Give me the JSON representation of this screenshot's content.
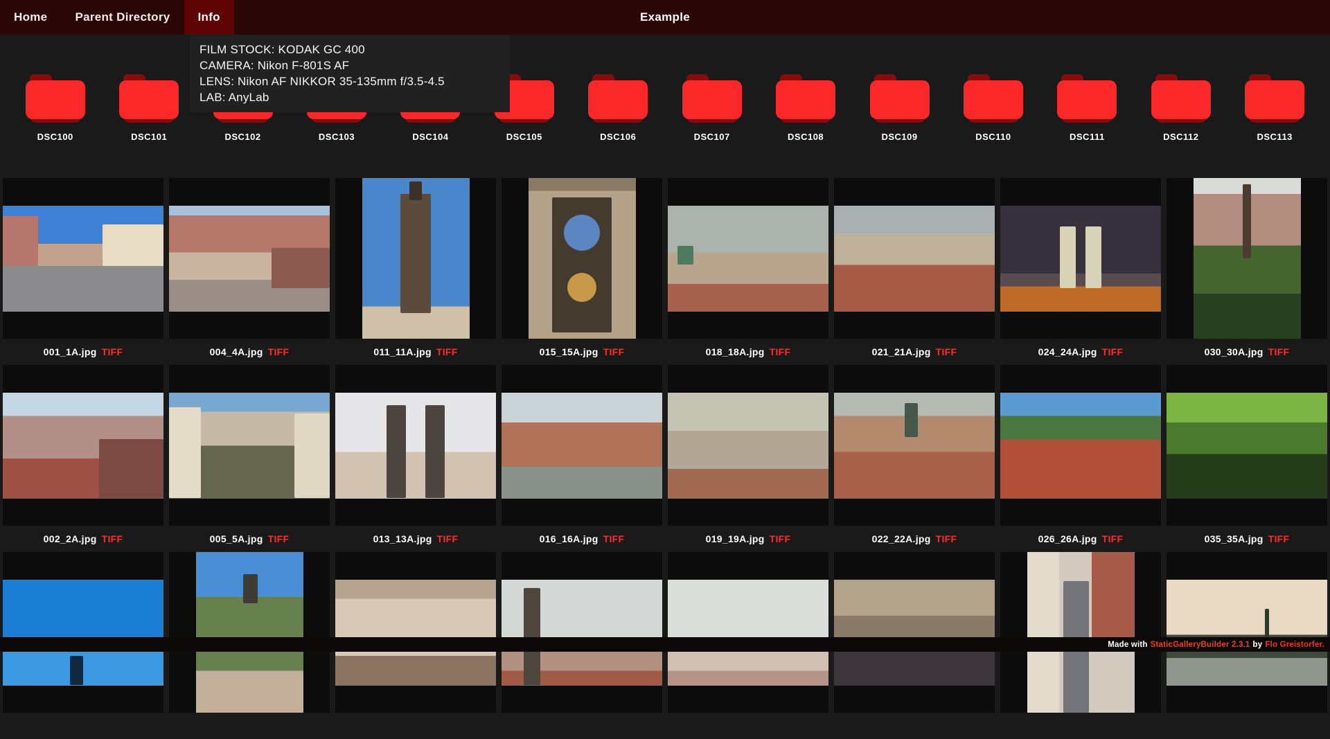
{
  "nav": {
    "items": [
      {
        "label": "Home",
        "active": false
      },
      {
        "label": "Parent Directory",
        "active": false
      },
      {
        "label": "Info",
        "active": true
      }
    ],
    "title": "Example"
  },
  "info_panel": {
    "lines": [
      "FILM STOCK: KODAK GC 400",
      "CAMERA: Nikon F-801S AF",
      "LENS: Nikon AF NIKKOR 35-135mm f/3.5-4.5",
      "LAB: AnyLab"
    ]
  },
  "folders": [
    "DSC100",
    "DSC101",
    "DSC102",
    "DSC103",
    "DSC104",
    "DSC105",
    "DSC106",
    "DSC107",
    "DSC108",
    "DSC109",
    "DSC110",
    "DSC111",
    "DSC112",
    "DSC113"
  ],
  "gallery": {
    "items": [
      {
        "name": "001_1A.jpg",
        "tag": "TIFF",
        "orientation": "landscape",
        "bands": [
          [
            "#3f81d6",
            0,
            36
          ],
          [
            "#c2a28c",
            36,
            57
          ],
          [
            "#8b8b8e",
            57,
            100
          ]
        ],
        "stripes": [
          [
            "#b5766d",
            0,
            22,
            10,
            57
          ],
          [
            "#e8dcc4",
            62,
            100,
            18,
            57
          ]
        ]
      },
      {
        "name": "004_4A.jpg",
        "tag": "TIFF",
        "orientation": "landscape",
        "bands": [
          [
            "#a9c2da",
            0,
            9
          ],
          [
            "#b5786a",
            9,
            44
          ],
          [
            "#c9b5a0",
            44,
            70
          ],
          [
            "#9b8e86",
            70,
            100
          ]
        ],
        "stripes": [
          [
            "#8d5a50",
            64,
            100,
            40,
            78
          ]
        ]
      },
      {
        "name": "011_11A.jpg",
        "tag": "TIFF",
        "orientation": "portrait",
        "bands": [
          [
            "#4a86cc",
            0,
            80
          ],
          [
            "#cdbfa8",
            80,
            100
          ]
        ],
        "stripes": [
          [
            "#5c4a3c",
            36,
            64,
            10,
            84
          ],
          [
            "#3e3128",
            44,
            56,
            2,
            14
          ]
        ]
      },
      {
        "name": "015_15A.jpg",
        "tag": "TIFF",
        "orientation": "portrait",
        "bands": [
          [
            "#8a7a64",
            0,
            8
          ],
          [
            "#b3a288",
            8,
            100
          ]
        ],
        "stripes": [
          [
            "#453a2e",
            22,
            78,
            12,
            96
          ]
        ],
        "dials": [
          [
            "#5b86c2",
            50,
            34,
            26
          ],
          [
            "#c79a4a",
            50,
            68,
            21
          ]
        ]
      },
      {
        "name": "018_18A.jpg",
        "tag": "TIFF",
        "orientation": "landscape",
        "bands": [
          [
            "#aab4ad",
            0,
            44
          ],
          [
            "#b9a48d",
            44,
            74
          ],
          [
            "#a5604e",
            74,
            100
          ]
        ],
        "stripes": [
          [
            "#4e7a5e",
            6,
            16,
            38,
            56
          ]
        ]
      },
      {
        "name": "021_21A.jpg",
        "tag": "TIFF",
        "orientation": "landscape",
        "bands": [
          [
            "#a9b0b2",
            0,
            26
          ],
          [
            "#bfb099",
            26,
            56
          ],
          [
            "#a75b47",
            56,
            100
          ]
        ]
      },
      {
        "name": "024_24A.jpg",
        "tag": "TIFF",
        "orientation": "landscape",
        "bands": [
          [
            "#36313c",
            0,
            64
          ],
          [
            "#584c50",
            64,
            76
          ],
          [
            "#c06a28",
            76,
            100
          ]
        ],
        "stripes": [
          [
            "#d8d2b6",
            37,
            47,
            20,
            78
          ],
          [
            "#d8d2b6",
            53,
            63,
            20,
            78
          ]
        ]
      },
      {
        "name": "030_30A.jpg",
        "tag": "TIFF",
        "orientation": "portrait",
        "bands": [
          [
            "#d9dcd6",
            0,
            10
          ],
          [
            "#b28d7f",
            10,
            42
          ],
          [
            "#45652f",
            42,
            72
          ],
          [
            "#27401f",
            72,
            100
          ]
        ],
        "stripes": [
          [
            "#4a3a30",
            46,
            54,
            4,
            50
          ]
        ]
      },
      {
        "name": "002_2A.jpg",
        "tag": "TIFF",
        "orientation": "landscape",
        "bands": [
          [
            "#c2d6e4",
            0,
            22
          ],
          [
            "#b29088",
            22,
            62
          ],
          [
            "#9e5044",
            62,
            100
          ]
        ],
        "stripes": [
          [
            "#7c4a42",
            60,
            100,
            44,
            100
          ]
        ]
      },
      {
        "name": "005_5A.jpg",
        "tag": "TIFF",
        "orientation": "landscape",
        "bands": [
          [
            "#78a8d2",
            0,
            18
          ],
          [
            "#c6baa6",
            18,
            50
          ],
          [
            "#66664e",
            50,
            100
          ]
        ],
        "stripes": [
          [
            "#e4dcc8",
            0,
            20,
            14,
            100
          ],
          [
            "#e0d8c4",
            78,
            100,
            20,
            100
          ]
        ]
      },
      {
        "name": "013_13A.jpg",
        "tag": "TIFF",
        "orientation": "landscape",
        "bands": [
          [
            "#e6e6e8",
            0,
            56
          ],
          [
            "#d2c2b2",
            56,
            100
          ]
        ],
        "stripes": [
          [
            "#4c443e",
            32,
            44,
            12,
            100
          ],
          [
            "#4c443e",
            56,
            68,
            12,
            100
          ]
        ]
      },
      {
        "name": "016_16A.jpg",
        "tag": "TIFF",
        "orientation": "landscape",
        "bands": [
          [
            "#c9d2d6",
            0,
            28
          ],
          [
            "#b07258",
            28,
            70
          ],
          [
            "#88928a",
            70,
            100
          ]
        ]
      },
      {
        "name": "019_19A.jpg",
        "tag": "TIFF",
        "orientation": "landscape",
        "bands": [
          [
            "#c4c4b2",
            0,
            36
          ],
          [
            "#b2a695",
            36,
            72
          ],
          [
            "#a06950",
            72,
            100
          ]
        ]
      },
      {
        "name": "022_22A.jpg",
        "tag": "TIFF",
        "orientation": "landscape",
        "bands": [
          [
            "#b5bab3",
            0,
            22
          ],
          [
            "#b48a6e",
            22,
            56
          ],
          [
            "#a9604a",
            56,
            100
          ]
        ],
        "stripes": [
          [
            "#46584a",
            44,
            52,
            10,
            42
          ]
        ]
      },
      {
        "name": "026_26A.jpg",
        "tag": "TIFF",
        "orientation": "landscape",
        "bands": [
          [
            "#5b9bd2",
            0,
            22
          ],
          [
            "#49773f",
            22,
            44
          ],
          [
            "#b14f38",
            44,
            100
          ]
        ]
      },
      {
        "name": "035_35A.jpg",
        "tag": "TIFF",
        "orientation": "landscape",
        "bands": [
          [
            "#7cb444",
            0,
            28
          ],
          [
            "#4a7a2e",
            28,
            58
          ],
          [
            "#243c1a",
            58,
            100
          ]
        ]
      },
      {
        "name": null,
        "tag": null,
        "orientation": "landscape",
        "bands": [
          [
            "#1a7fd4",
            0,
            55
          ],
          [
            "#3c98e0",
            55,
            100
          ]
        ],
        "stripes": [
          [
            "#12283e",
            42,
            50,
            72,
            100
          ]
        ]
      },
      {
        "name": null,
        "tag": null,
        "orientation": "portrait",
        "bands": [
          [
            "#4a8ed6",
            0,
            28
          ],
          [
            "#66804e",
            28,
            74
          ],
          [
            "#c2b09a",
            74,
            100
          ]
        ],
        "stripes": [
          [
            "#3e3a34",
            44,
            58,
            14,
            32
          ]
        ]
      },
      {
        "name": null,
        "tag": null,
        "orientation": "landscape",
        "bands": [
          [
            "#b8a48e",
            0,
            18
          ],
          [
            "#d8c9b6",
            18,
            72
          ],
          [
            "#8a7460",
            72,
            100
          ]
        ]
      },
      {
        "name": null,
        "tag": null,
        "orientation": "landscape",
        "bands": [
          [
            "#d4d8d6",
            0,
            58
          ],
          [
            "#b29181",
            58,
            86
          ],
          [
            "#a05a46",
            86,
            100
          ]
        ],
        "stripes": [
          [
            "#4e463c",
            14,
            24,
            8,
            100
          ]
        ]
      },
      {
        "name": null,
        "tag": null,
        "orientation": "landscape",
        "bands": [
          [
            "#dadedb",
            0,
            58
          ],
          [
            "#cfc0b2",
            58,
            86
          ],
          [
            "#b49486",
            86,
            100
          ]
        ]
      },
      {
        "name": null,
        "tag": null,
        "orientation": "landscape",
        "bands": [
          [
            "#b2a38b",
            0,
            34
          ],
          [
            "#8a7a68",
            34,
            56
          ],
          [
            "#3c363a",
            56,
            100
          ]
        ]
      },
      {
        "name": null,
        "tag": null,
        "orientation": "portrait",
        "bands": [
          [
            "#d2cabe",
            0,
            100
          ]
        ],
        "stripes": [
          [
            "#e2dacb",
            0,
            30,
            0,
            100
          ],
          [
            "#73737a",
            34,
            58,
            18,
            100
          ],
          [
            "#a85a48",
            60,
            100,
            0,
            58
          ]
        ]
      },
      {
        "name": null,
        "tag": null,
        "orientation": "landscape",
        "bands": [
          [
            "#ead9c2",
            0,
            52
          ],
          [
            "#3e4a3c",
            52,
            74
          ],
          [
            "#8e968c",
            74,
            100
          ]
        ],
        "stripes": [
          [
            "#2e3a30",
            61,
            64,
            28,
            56
          ]
        ]
      }
    ]
  },
  "footer": {
    "made_with": "Made with",
    "builder": "StaticGalleryBuilder 2.3.1",
    "by": "by",
    "author": "Flo Greistorfer."
  },
  "colors": {
    "nav_bg": "#2b0707",
    "nav_active_bg": "#5e0404",
    "page_bg": "#1a1a1a",
    "tile_bg": "#0c0c0c",
    "folder_red": "#fa2828",
    "folder_dark_red": "#850d0d",
    "tag_red": "#f23030",
    "builder_link_red": "#e8402c",
    "author_link_red": "#f03224"
  }
}
